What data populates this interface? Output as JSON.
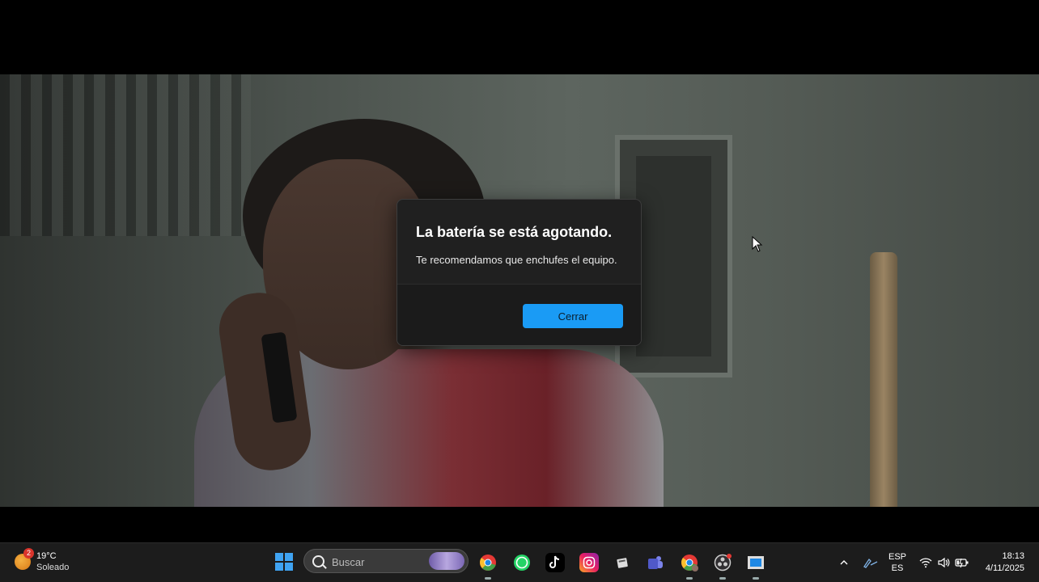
{
  "dialog": {
    "title": "La batería se está agotando.",
    "message": "Te recomendamos que enchufes el equipo.",
    "close_label": "Cerrar"
  },
  "taskbar": {
    "weather": {
      "temp": "19°C",
      "condition": "Soleado",
      "badge": "2"
    },
    "search_placeholder": "Buscar",
    "apps": [
      "chrome-icon",
      "whatsapp-icon",
      "tiktok-icon",
      "instagram-icon",
      "files-icon",
      "teams-icon",
      "chrome-profile-icon",
      "obs-icon",
      "app-window-icon"
    ],
    "tray": {
      "lang_top": "ESP",
      "lang_bottom": "ES"
    },
    "clock": {
      "time": "18:13",
      "date": "4/11/2025"
    }
  },
  "colors": {
    "accent": "#1a9bf5",
    "dialog_bg": "#202020",
    "taskbar_bg": "#1c1c1c"
  }
}
